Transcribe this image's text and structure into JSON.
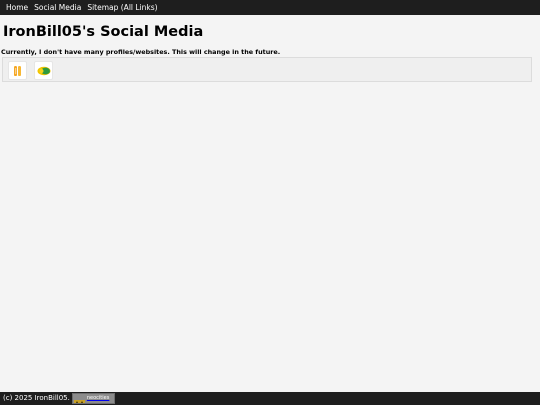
{
  "nav": {
    "items": [
      {
        "label": "Home"
      },
      {
        "label": "Social Media"
      },
      {
        "label": "Sitemap (All Links)"
      }
    ]
  },
  "main": {
    "title": "IronBill05's Social Media",
    "intro": "Currently, I don't have many profiles/websites. This will change in the future.",
    "profiles": [
      {
        "icon": "orange-logo-icon",
        "color": "#f5a623"
      },
      {
        "icon": "green-logo-icon",
        "color": "#2e9b3f"
      }
    ]
  },
  "footer": {
    "text": "(c) 2025 IronBill05.",
    "badge_text": "neocities"
  },
  "colors": {
    "nav_bg": "#1e1e1e",
    "page_bg": "#f4f4f4",
    "footer_bg": "#1e1e1e"
  }
}
